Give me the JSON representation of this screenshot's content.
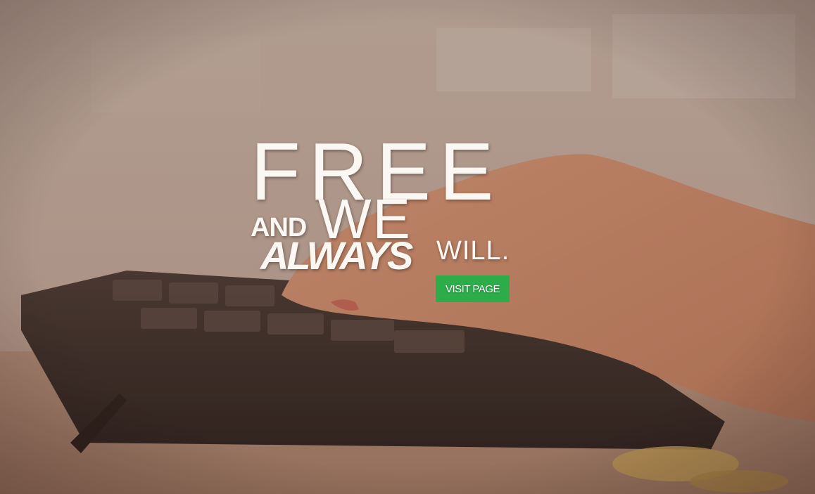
{
  "hero": {
    "headline": {
      "word1": "FREE",
      "word2": "AND",
      "word3": "WE",
      "word4": "ALWAYS",
      "word5": "WILL."
    },
    "cta_label": "VISIT PAGE"
  },
  "colors": {
    "cta_background": "#2dac4a",
    "headline_text": "#fbf7f3"
  }
}
